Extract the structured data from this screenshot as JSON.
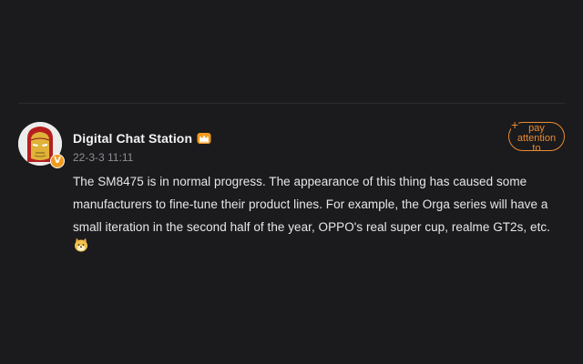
{
  "post": {
    "author": {
      "name": "Digital Chat Station",
      "verified_badge": "V"
    },
    "timestamp": "22-3-3 11:11",
    "follow_button": {
      "plus": "+",
      "label": "pay attention to"
    },
    "text": "The SM8475 is in normal progress. The appearance of this thing has caused some manufacturers to fine-tune their product lines. For example, the Orga series will have a small iteration in the second half of the year, OPPO's real super cup, realme GT2s, etc.",
    "icons": {
      "avatar": "iron-man-avatar",
      "level": "crown-level-icon",
      "emoji": "doge-emoji"
    }
  },
  "colors": {
    "background": "#1b1a1d",
    "accent": "#e88c33",
    "badge": "#f09b1f",
    "text": "#e7e7e7",
    "muted": "#8e8e93"
  }
}
